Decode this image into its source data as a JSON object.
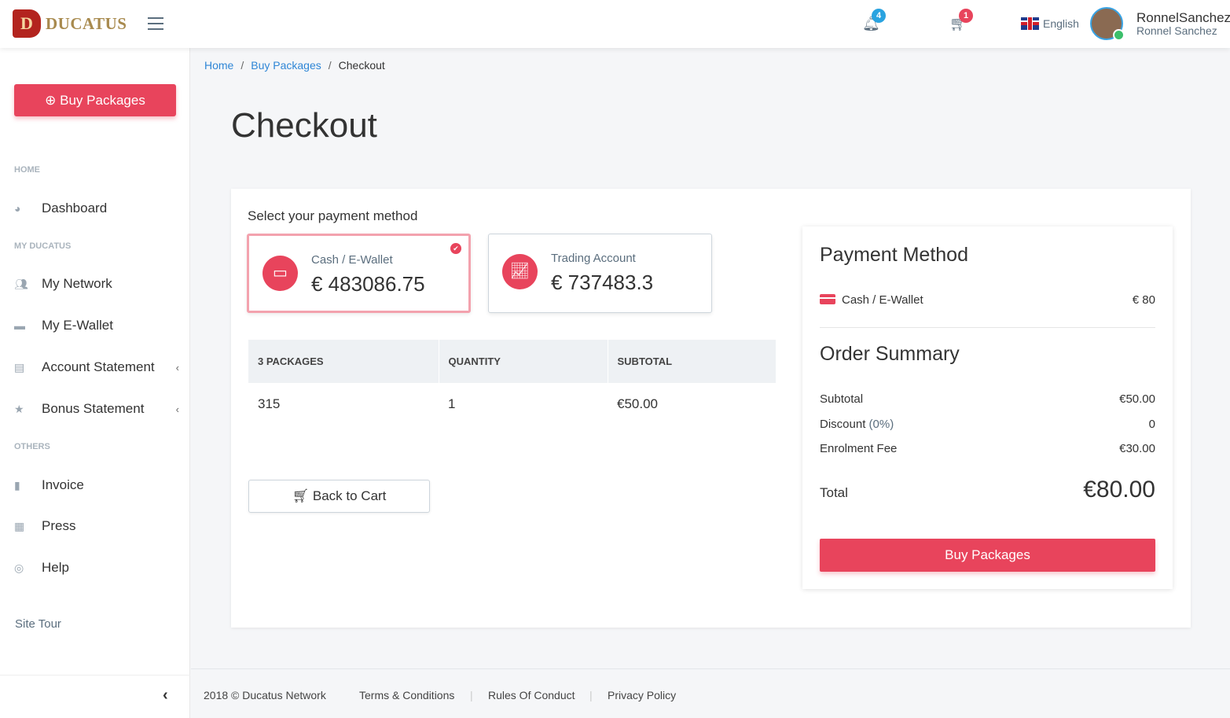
{
  "header": {
    "brand": "DUCATUS",
    "notifications_count": "4",
    "cart_count": "1",
    "language": "English",
    "username": "RonnelSanchez",
    "full_name": "Ronnel Sanchez",
    "colors": {
      "accent": "#e8445c",
      "notif_badge": "#2aa3e0"
    }
  },
  "sidebar": {
    "buy_button": "Buy Packages",
    "sections": [
      {
        "title": "HOME",
        "items": [
          {
            "label": "Dashboard",
            "icon": "dashboard-icon"
          }
        ]
      },
      {
        "title": "MY DUCATUS",
        "items": [
          {
            "label": "My Network",
            "icon": "users-icon"
          },
          {
            "label": "My E-Wallet",
            "icon": "wallet-icon"
          },
          {
            "label": "Account Statement",
            "icon": "id-card-icon",
            "expandable": true
          },
          {
            "label": "Bonus Statement",
            "icon": "star-icon",
            "expandable": true
          }
        ]
      },
      {
        "title": "OTHERS",
        "items": [
          {
            "label": "Invoice",
            "icon": "file-icon"
          },
          {
            "label": "Press",
            "icon": "newspaper-icon"
          },
          {
            "label": "Help",
            "icon": "lifebuoy-icon"
          }
        ]
      }
    ],
    "site_tour": "Site Tour"
  },
  "breadcrumb": [
    "Home",
    "Buy Packages",
    "Checkout"
  ],
  "page_title": "Checkout",
  "payment": {
    "prompt": "Select your payment method",
    "methods": [
      {
        "label": "Cash / E-Wallet",
        "amount": "€ 483086.75",
        "selected": true
      },
      {
        "label": "Trading Account",
        "amount": "€ 737483.3",
        "selected": false
      }
    ]
  },
  "table": {
    "headers": [
      "3 PACKAGES",
      "QUANTITY",
      "SUBTOTAL"
    ],
    "rows": [
      [
        "315",
        "1",
        "€50.00"
      ]
    ]
  },
  "back_button": "Back to Cart",
  "summary": {
    "payment_title": "Payment Method",
    "method_label": "Cash / E-Wallet",
    "method_amount": "€ 80",
    "order_title": "Order Summary",
    "subtotal_label": "Subtotal",
    "subtotal": "€50.00",
    "discount_label": "Discount",
    "discount_pct": "(0%)",
    "discount": "0",
    "fee_label": "Enrolment Fee",
    "fee": "€30.00",
    "total_label": "Total",
    "total": "€80.00",
    "buy_button": "Buy Packages"
  },
  "footer": {
    "copyright": "2018 © Ducatus Network",
    "links": [
      "Terms & Conditions",
      "Rules Of Conduct",
      "Privacy Policy"
    ]
  }
}
